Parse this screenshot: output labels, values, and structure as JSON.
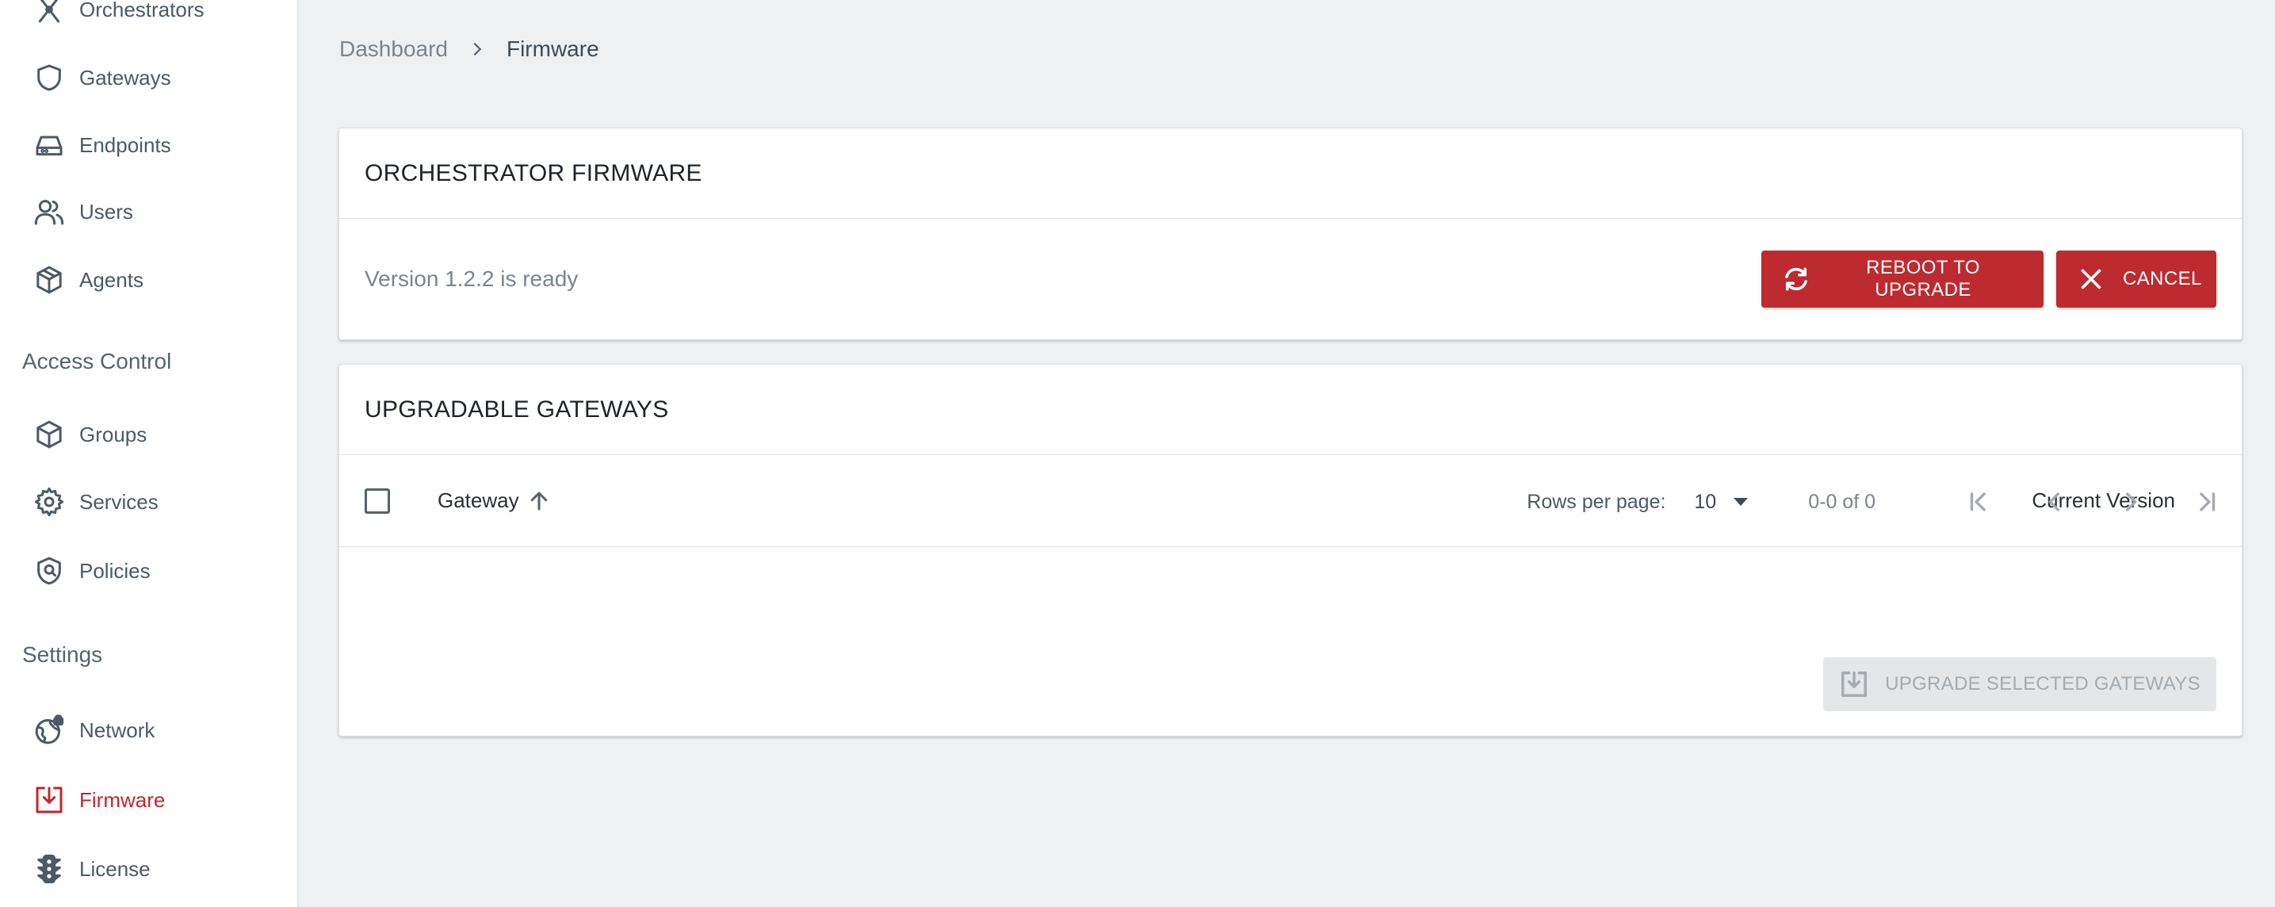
{
  "sidebar": {
    "items": [
      {
        "label": "Orchestrators",
        "icon": "orchestrator-icon"
      },
      {
        "label": "Gateways",
        "icon": "shield-icon"
      },
      {
        "label": "Endpoints",
        "icon": "hard-drive-icon"
      },
      {
        "label": "Users",
        "icon": "users-icon"
      },
      {
        "label": "Agents",
        "icon": "box-icon"
      }
    ],
    "sections": [
      {
        "title": "Access Control",
        "items": [
          {
            "label": "Groups",
            "icon": "box-icon"
          },
          {
            "label": "Services",
            "icon": "gear-icon"
          },
          {
            "label": "Policies",
            "icon": "shield-check-icon"
          }
        ]
      },
      {
        "title": "Settings",
        "items": [
          {
            "label": "Network",
            "icon": "globe-lock-icon"
          },
          {
            "label": "Firmware",
            "icon": "download-box-icon",
            "active": true
          },
          {
            "label": "License",
            "icon": "traffic-light-icon"
          }
        ]
      }
    ]
  },
  "breadcrumb": {
    "root": "Dashboard",
    "current": "Firmware"
  },
  "firmware_card": {
    "title": "ORCHESTRATOR FIRMWARE",
    "status": "Version 1.2.2 is ready",
    "reboot_label": "REBOOT TO UPGRADE",
    "cancel_label": "CANCEL"
  },
  "gateways_card": {
    "title": "UPGRADABLE GATEWAYS",
    "columns": {
      "gateway": "Gateway",
      "current_version": "Current Version"
    },
    "pagination": {
      "rows_label": "Rows per page:",
      "rows_value": "10",
      "range": "0-0 of 0"
    },
    "upgrade_label": "UPGRADE SELECTED GATEWAYS"
  },
  "colors": {
    "accent": "#bd2a2f",
    "background": "#eef0f2",
    "sidebar": "#ffffff"
  }
}
